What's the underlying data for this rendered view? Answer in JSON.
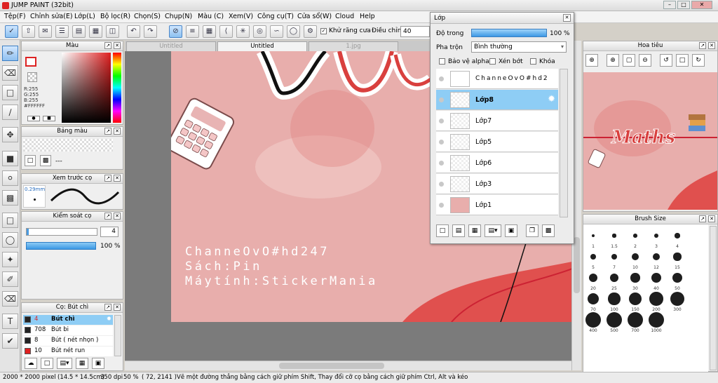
{
  "window": {
    "title": "JUMP PAINT (32bit)"
  },
  "menu": [
    "Tệp(F)",
    "Chỉnh sửa(E)",
    "Lớp(L)",
    "Bộ lọc(R)",
    "Chọn(S)",
    "Chụp(N)",
    "Màu (C)",
    "Xem(V)",
    "Công cụ(T)",
    "Cửa sổ(W)",
    "Cloud",
    "Help"
  ],
  "toolbar": {
    "antialias_label": "Khử răng cưa",
    "adjust_label": "Điều chỉnh",
    "adjust_value": "40"
  },
  "tabs": [
    "Untitled",
    "Untitled",
    "1.jpg"
  ],
  "color_panel": {
    "title": "Màu",
    "r": "R:255",
    "g": "G:255",
    "b": "B:255",
    "hex": "#FFFFFF"
  },
  "palette_panel": {
    "title": "Bảng màu",
    "empty": "---"
  },
  "brush_preview": {
    "title": "Xem trước cọ",
    "size": "0.29mm"
  },
  "brush_control": {
    "title": "Kiểm soát cọ",
    "size_value": "4",
    "opacity_value": "100 %"
  },
  "brush_list": {
    "title": "Cọ: Bút chì",
    "items": [
      {
        "size": "4",
        "name": "Bút chì",
        "color": "#222222"
      },
      {
        "size": "708",
        "name": "Bút bi",
        "color": "#222222"
      },
      {
        "size": "8",
        "name": "Bút ( nét nhọn )",
        "color": "#222222"
      },
      {
        "size": "10",
        "name": "Bút nét run",
        "color": "#e02020"
      }
    ]
  },
  "canvas": {
    "lines": [
      "ChanneOvO#hd247",
      "Sách:Pin",
      "Máytính:StickerMania"
    ]
  },
  "layer_panel": {
    "title": "Lớp",
    "opacity_label": "Độ trong",
    "opacity_value": "100 %",
    "opacity_fraction": 1.0,
    "blend_label": "Pha trộn",
    "blend_value": "Bình thường",
    "protect_alpha": "Bảo vệ alpha",
    "clip": "Xén bớt",
    "lock": "Khóa",
    "layers": [
      "ChanneOvO#hd2",
      "Lớp8",
      "Lớp7",
      "Lớp5",
      "Lớp6",
      "Lớp3",
      "Lớp1"
    ],
    "selected_index": 1
  },
  "navigator": {
    "title": "Hoa tiêu",
    "preview_text": "Maths"
  },
  "brush_size": {
    "title": "Brush Size",
    "sizes": [
      "1",
      "1.5",
      "2",
      "3",
      "4",
      "5",
      "7",
      "10",
      "12",
      "15",
      "20",
      "25",
      "30",
      "40",
      "50",
      "70",
      "100",
      "150",
      "200",
      "300",
      "400",
      "500",
      "700",
      "1000"
    ]
  },
  "status": {
    "size": "2000 * 2000 pixel",
    "cm": "(14.5 * 14.5cm)",
    "dpi": "350 dpi",
    "zoom": "50 %",
    "coords": "( 72, 2141 )",
    "hint": "Vẽ một đường thẳng bằng cách giữ phím Shift, Thay đổi cỡ cọ bằng cách giữ phím Ctrl, Alt và kéo"
  }
}
